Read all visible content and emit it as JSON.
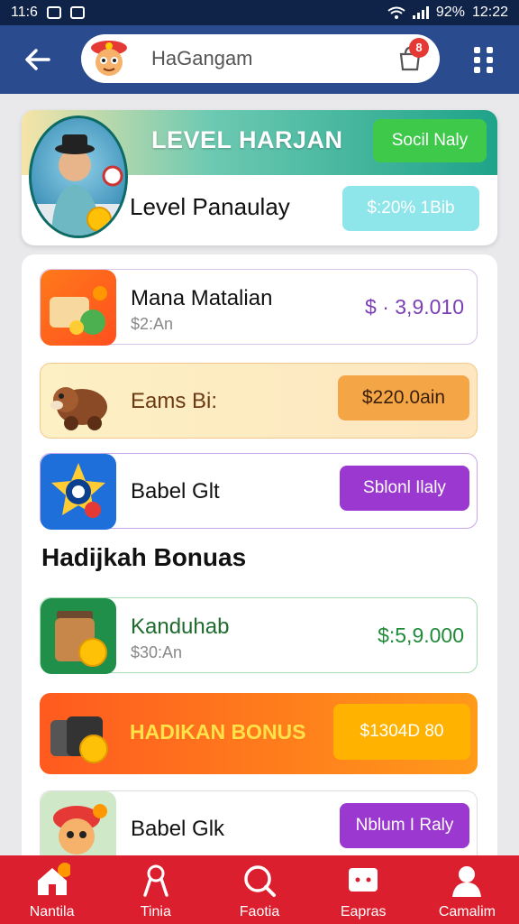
{
  "status_bar": {
    "time": "11:6",
    "battery": "92%",
    "clock": "12:22"
  },
  "header": {
    "back_icon": "arrow-left-icon",
    "search_text": "HaGangam",
    "cart_badge": "8",
    "menu_icon": "grid-dots-icon"
  },
  "level_card": {
    "title": "LEVEL HARJAN",
    "action_label": "Socil Naly",
    "subtitle": "Level Panaulay",
    "pill_label": "$:20% 1Bib"
  },
  "rows": [
    {
      "title": "Mana Matalian",
      "sub": "$2:An",
      "price": "$ · 3,9.010",
      "price_color": "#7b3fb5"
    },
    {
      "title": "Eams Bi:",
      "button": "$220.0ain",
      "button_color": "#f4a646"
    },
    {
      "title": "Babel Glt",
      "button": "Sblonl Ilaly",
      "button_color": "#9b38d0"
    }
  ],
  "section_title": "Hadijkah Bonuas",
  "bonus_rows": [
    {
      "title": "Kanduhab",
      "sub": "$30:An",
      "price": "$:5,9.000",
      "price_color": "#1f8a3a"
    },
    {
      "title": "HADIKAN BONUS",
      "button": "$1304D 80",
      "button_color": "#ffb300"
    },
    {
      "title": "Babel Glk",
      "button": "Nblum I Raly",
      "button_color": "#9b38d0"
    }
  ],
  "nav": [
    {
      "label": "Nantila",
      "icon": "home-icon"
    },
    {
      "label": "Tinia",
      "icon": "ribbon-icon"
    },
    {
      "label": "Faotia",
      "icon": "search-icon"
    },
    {
      "label": "Eapras",
      "icon": "chat-icon"
    },
    {
      "label": "Camalim",
      "icon": "profile-icon"
    }
  ],
  "colors": {
    "header": "#2a4c8f",
    "nav": "#dc1f2e",
    "accent_green": "#3ec94a"
  }
}
